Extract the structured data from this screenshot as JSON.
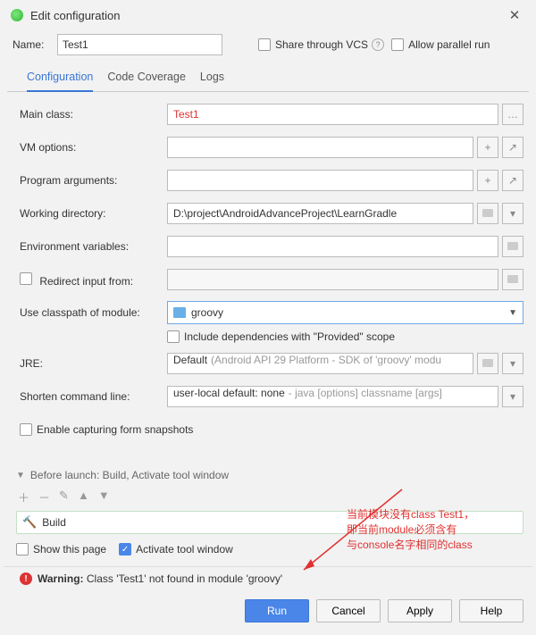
{
  "title": "Edit configuration",
  "name_label": "Name:",
  "name_value": "Test1",
  "share_vcs_label": "Share through VCS",
  "allow_parallel_label": "Allow parallel run",
  "tabs": {
    "configuration": "Configuration",
    "coverage": "Code Coverage",
    "logs": "Logs"
  },
  "form": {
    "main_class_label": "Main class:",
    "main_class_value": "Test1",
    "vm_options_label": "VM options:",
    "vm_options_value": "",
    "program_args_label": "Program arguments:",
    "program_args_value": "",
    "working_dir_label": "Working directory:",
    "working_dir_value": "D:\\project\\AndroidAdvanceProject\\LearnGradle",
    "env_vars_label": "Environment variables:",
    "env_vars_value": "",
    "redirect_label": "Redirect input from:",
    "redirect_value": "",
    "classpath_label": "Use classpath of module:",
    "classpath_value": "groovy",
    "include_deps_label": "Include dependencies with \"Provided\" scope",
    "jre_label": "JRE:",
    "jre_value": "Default",
    "jre_hint": "(Android API 29 Platform - SDK of 'groovy' modu",
    "shorten_label": "Shorten command line:",
    "shorten_value": "user-local default: none",
    "shorten_hint": "- java [options] classname [args]",
    "enable_snapshots_label": "Enable capturing form snapshots"
  },
  "before": {
    "header": "Before launch: Build, Activate tool window",
    "build_label": "Build",
    "show_page_label": "Show this page",
    "activate_label": "Activate tool window"
  },
  "warning_bold": "Warning:",
  "warning_text": " Class 'Test1' not found in module 'groovy'",
  "buttons": {
    "run": "Run",
    "cancel": "Cancel",
    "apply": "Apply",
    "help": "Help"
  },
  "annotation_line1": "当前模块没有class Test1，",
  "annotation_line2": "即当前module必须含有",
  "annotation_line3": "与console名字相同的class"
}
